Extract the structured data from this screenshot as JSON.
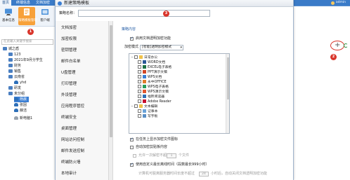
{
  "app": {
    "tabs": [
      {
        "label": "首页",
        "active": true
      },
      {
        "label": "终端信息",
        "active": false
      },
      {
        "label": "文档加密",
        "active": false
      }
    ],
    "user": "admin",
    "toolbar": [
      {
        "label": "基本信息",
        "icon": "computer-icon"
      },
      {
        "label": "策略模板管理",
        "icon": "template-icon",
        "selected": true
      },
      {
        "label": "客户端",
        "icon": "client-icon"
      }
    ],
    "search_placeholder": "在此输入关键字搜索",
    "tree": [
      {
        "label": "城之盾",
        "icon": "group",
        "level": 0
      },
      {
        "label": "123",
        "icon": "group",
        "level": 1
      },
      {
        "label": "2021年9月分学生",
        "icon": "group",
        "level": 1
      },
      {
        "label": "财务",
        "icon": "group",
        "level": 1
      },
      {
        "label": "销售",
        "icon": "group",
        "level": 1
      },
      {
        "label": "云南省",
        "icon": "group",
        "level": 1
      },
      {
        "label": "yhd",
        "icon": "user",
        "level": 2
      },
      {
        "label": "研发",
        "icon": "group",
        "level": 1
      },
      {
        "label": "未分组",
        "icon": "group",
        "level": 1
      },
      {
        "label": "杨晨",
        "icon": "user",
        "level": 2,
        "selected": true
      },
      {
        "label": "张因",
        "icon": "user",
        "level": 2
      },
      {
        "label": "薛洁",
        "icon": "user",
        "level": 2
      },
      {
        "label": "新电脑1",
        "icon": "off",
        "level": 2
      }
    ],
    "markers": {
      "m1": "1",
      "m2": "2",
      "m3": "3"
    }
  },
  "dialog": {
    "title": "新建策略模板",
    "name_label": "策略名称：",
    "name_value": "",
    "nav_items": [
      "文档加密",
      "加密权限",
      "密钥管理",
      "邮件白名单",
      "U盘管理",
      "打印管理",
      "外设管理",
      "应用程序管控",
      "终端安全",
      "桌面管理",
      "网站访问控制",
      "邮件发送控制",
      "终端防火墙",
      "本地审计"
    ],
    "section_title": "策略内容",
    "enable_doc_encrypt": {
      "label": "启用文档透明加密功能",
      "checked": true
    },
    "encrypt_mode": {
      "label": "加密模式",
      "value": "[智能]透明加密模式"
    },
    "file_types": [
      {
        "label": "日常办公",
        "level": 0,
        "expand": "−",
        "icon": "folder"
      },
      {
        "label": "WORD文档",
        "level": 1,
        "icon": "word"
      },
      {
        "label": "EXCEL电子表格",
        "level": 1,
        "icon": "excel"
      },
      {
        "label": "PPT演示文稿",
        "level": 1,
        "icon": "ppt"
      },
      {
        "label": "WPS文档",
        "level": 1,
        "icon": "wps"
      },
      {
        "label": "永中OFFICE",
        "level": 1,
        "icon": "yz"
      },
      {
        "label": "WPS电子表格",
        "level": 1,
        "icon": "wpsxls"
      },
      {
        "label": "WPS演示文稿",
        "level": 1,
        "icon": "wpsppt"
      },
      {
        "label": "福昕阅读器",
        "level": 1,
        "icon": "foxit"
      },
      {
        "label": "Adobe Reader",
        "level": 1,
        "icon": "adobe"
      },
      {
        "label": "文本编辑",
        "level": 0,
        "expand": "−",
        "icon": "folder"
      },
      {
        "label": "记事本",
        "level": 1,
        "icon": "notepad"
      },
      {
        "label": "写字板",
        "level": 1,
        "icon": "wordpad"
      }
    ],
    "opt_show_status": {
      "label": "在任务上显示加密文件图标",
      "checked": true
    },
    "opt_auto_encrypt_clipboard": {
      "label": "自动加密剪贴板内容",
      "checked": false
    },
    "opt_offline_prefix": "允许一次解密不超过",
    "opt_offline_num": "1",
    "opt_offline_suffix": "个文件",
    "opt_decrypt_large": {
      "label": "使用自定义最长离线时间（段数最长999小时）",
      "checked": true
    },
    "opt_bottom_prefix": "计算机可脱离服务器时间长度不超过",
    "opt_bottom_num": "24",
    "opt_bottom_suffix": "小时后，自动关闭文档透明加密功能"
  },
  "colors": {
    "accent": "#3a7bc8",
    "selected_toolbar": "#f7a13a",
    "marker": "#d9352b"
  }
}
